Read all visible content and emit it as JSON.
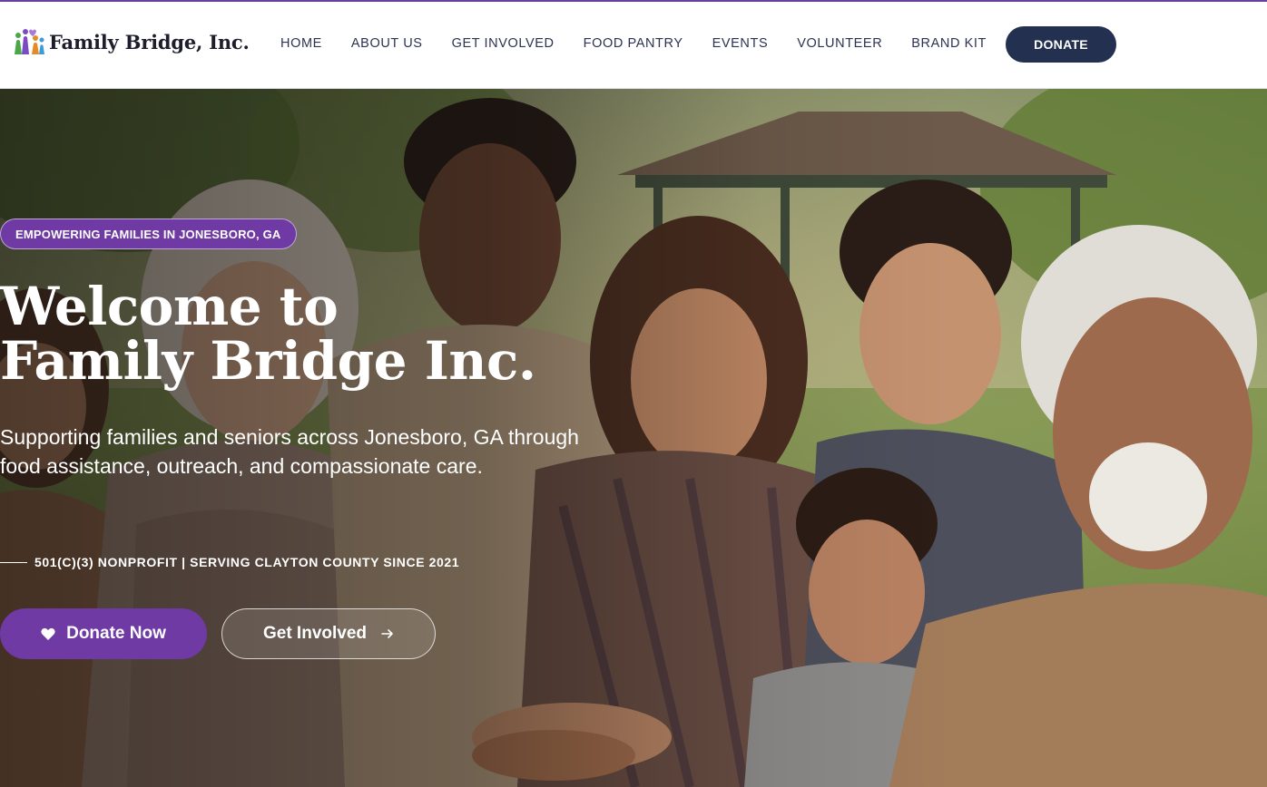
{
  "brand": {
    "name": "Family Bridge, Inc.",
    "logo_icon": "family-people-icon",
    "accent": "#6f3aa3",
    "navy": "#233050"
  },
  "nav": {
    "items": [
      {
        "label": "HOME"
      },
      {
        "label": "ABOUT US"
      },
      {
        "label": "GET INVOLVED"
      },
      {
        "label": "FOOD PANTRY"
      },
      {
        "label": "EVENTS"
      },
      {
        "label": "VOLUNTEER"
      },
      {
        "label": "BRAND KIT"
      }
    ],
    "donate_label": "DONATE"
  },
  "hero": {
    "tag": "EMPOWERING FAMILIES IN JONESBORO, GA",
    "title_line1": "Welcome to",
    "title_line2": "Family Bridge Inc.",
    "subtitle": "Supporting families and seniors across Jonesboro, GA through food assistance, outreach, and compassionate care.",
    "nonprofit": "501(C)(3) NONPROFIT | SERVING CLAYTON COUNTY SINCE 2021",
    "primary_button": {
      "label": "Donate Now",
      "icon": "heart-icon"
    },
    "secondary_button": {
      "label": "Get Involved",
      "icon": "arrow-right-icon"
    }
  }
}
